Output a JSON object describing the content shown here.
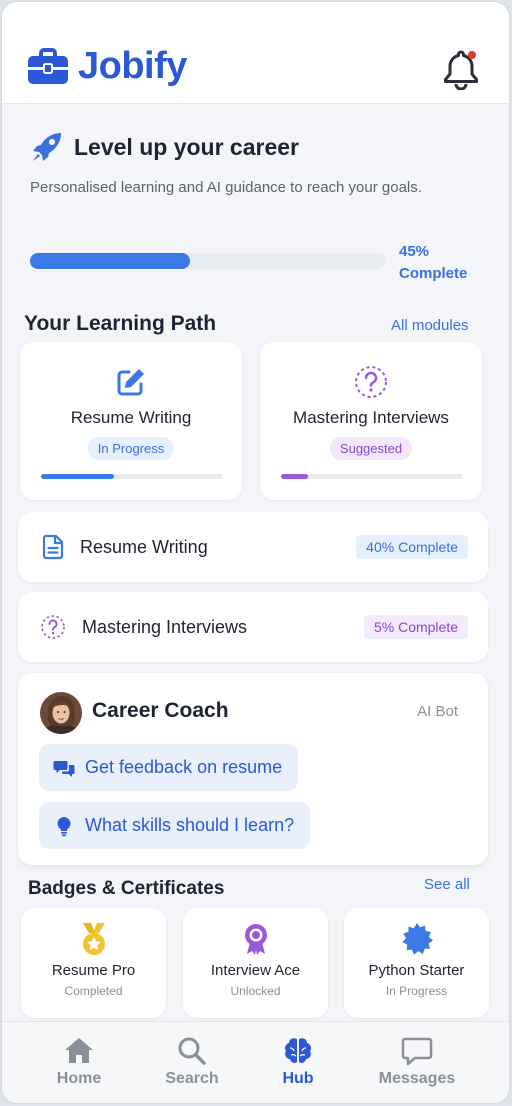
{
  "app": {
    "name": "Jobify"
  },
  "hero": {
    "title": "Level up your career",
    "subtitle": "Personalised learning and AI guidance to reach your goals.",
    "progress": 45,
    "progress_label": "45% Complete"
  },
  "learning_path": {
    "title": "Your Learning Path",
    "link": "All modules",
    "cards": [
      {
        "name": "Resume Writing",
        "status": "In Progress",
        "progress": 40,
        "icon": "edit-icon",
        "color": "#3b7ae5",
        "pill_bg": "#e6effc",
        "pill_color": "#3b70dd"
      },
      {
        "name": "Mastering Interviews",
        "status": "Suggested",
        "progress": 15,
        "icon": "question-circle-icon",
        "color": "#9b57e0",
        "pill_bg": "#f1e9fb",
        "pill_color": "#8a45d8"
      }
    ],
    "rows": [
      {
        "name": "Resume Writing",
        "badge": "40% Complete",
        "icon": "document-icon"
      },
      {
        "name": "Mastering Interviews",
        "badge": "5% Complete",
        "icon": "question-circle-icon"
      }
    ]
  },
  "coach": {
    "title": "Career Coach",
    "tag": "AI Bot",
    "chips": [
      {
        "label": "Get feedback on resume",
        "icon": "chat-bubbles-icon"
      },
      {
        "label": "What skills should I learn?",
        "icon": "lightbulb-icon"
      }
    ]
  },
  "badges": {
    "title": "Badges & Certificates",
    "link": "See all",
    "items": [
      {
        "name": "Resume Pro",
        "status": "Completed",
        "icon": "medal-icon",
        "color": "#f1c232"
      },
      {
        "name": "Interview Ace",
        "status": "Unlocked",
        "icon": "award-ribbon-icon",
        "color": "#9b57e0"
      },
      {
        "name": "Python Starter",
        "status": "In Progress",
        "icon": "starburst-badge-icon",
        "color": "#3b7ae5"
      }
    ]
  },
  "nav": {
    "items": [
      {
        "label": "Home",
        "icon": "home-icon"
      },
      {
        "label": "Search",
        "icon": "search-icon"
      },
      {
        "label": "Hub",
        "icon": "brain-icon",
        "active": true
      },
      {
        "label": "Messages",
        "icon": "message-icon"
      }
    ]
  },
  "colors": {
    "brand": "#2c57d6",
    "accent": "#3b7ae5",
    "purple": "#9b57e0",
    "notification": "#e0392b"
  }
}
